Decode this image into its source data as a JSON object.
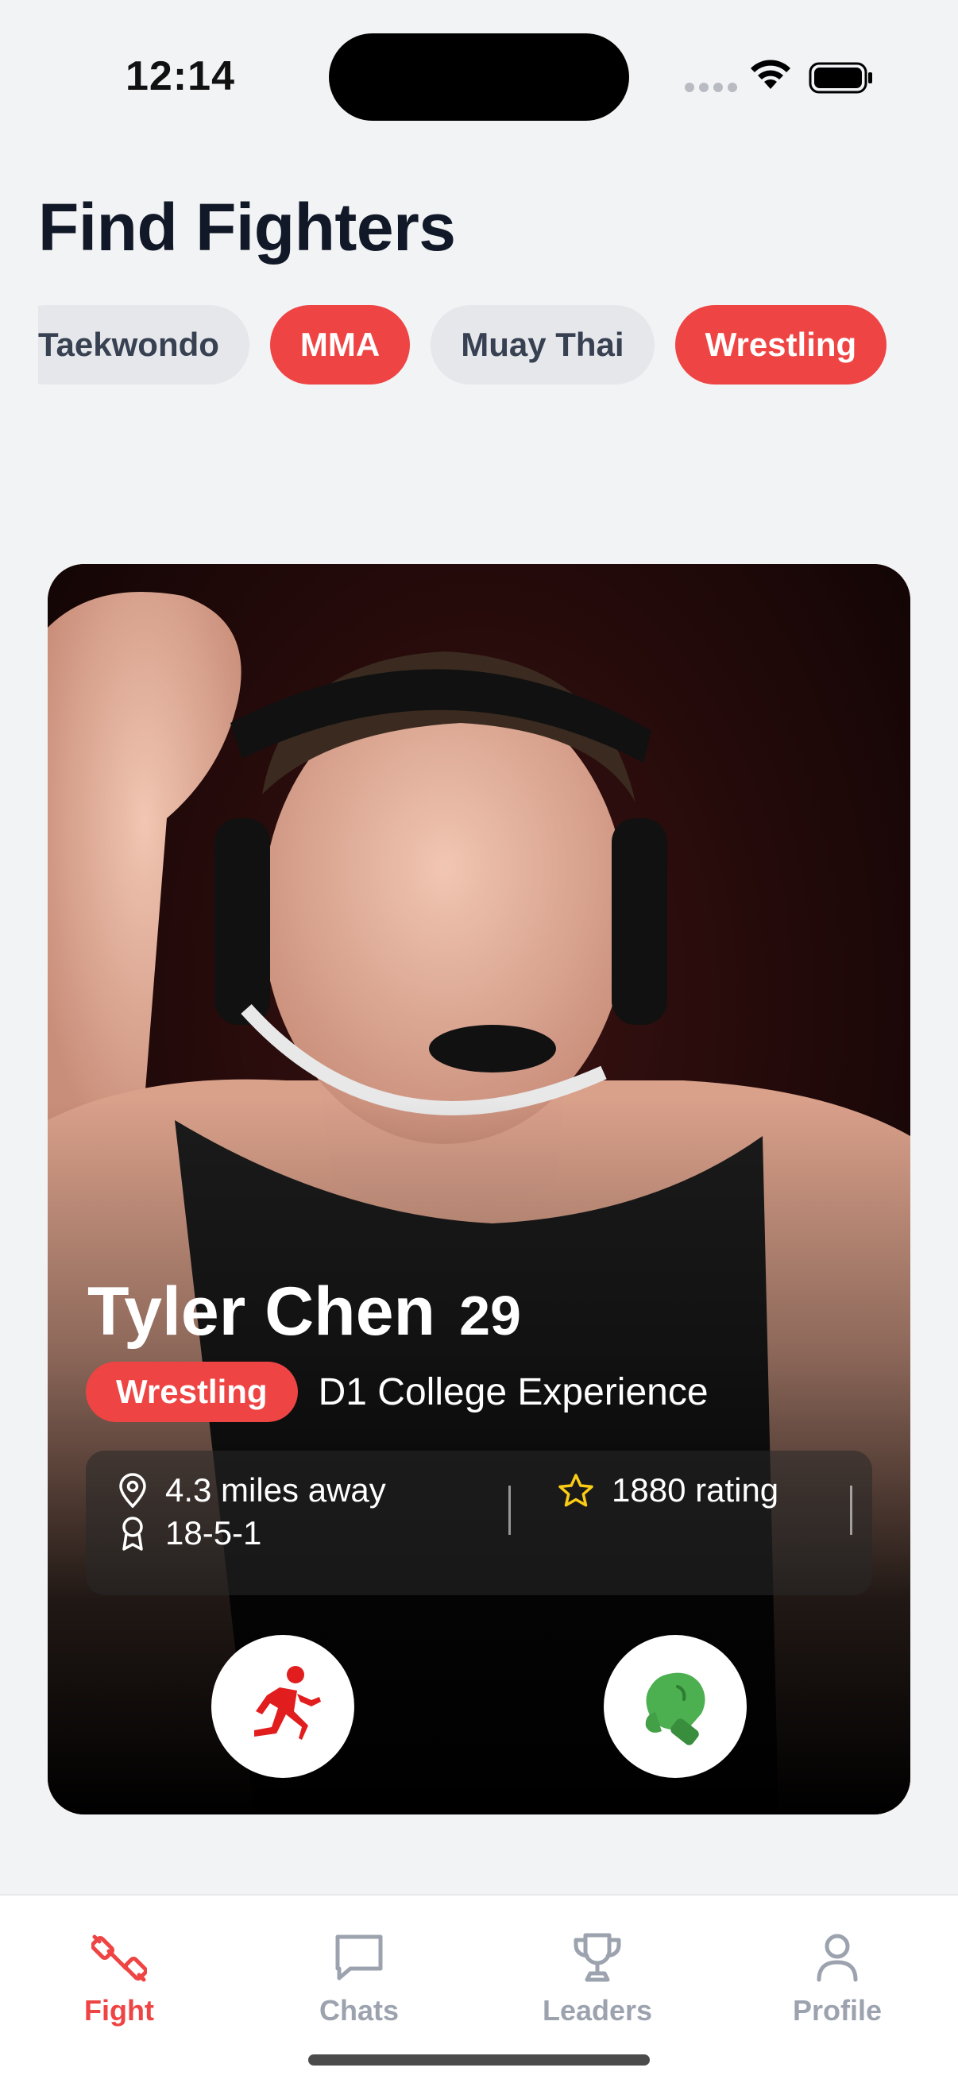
{
  "status": {
    "time": "12:14"
  },
  "header": {
    "title": "Find Fighters"
  },
  "filters": [
    {
      "label": "Taekwondo",
      "selected": false
    },
    {
      "label": "MMA",
      "selected": true
    },
    {
      "label": "Muay Thai",
      "selected": false
    },
    {
      "label": "Wrestling",
      "selected": true
    }
  ],
  "card": {
    "name": "Tyler Chen",
    "age": "29",
    "sport": "Wrestling",
    "experience": "D1 College Experience",
    "distance": "4.3 miles away",
    "rating": "1880 rating",
    "record": "18-5-1",
    "actions": {
      "pass_icon": "running-person-icon",
      "fight_icon": "boxing-glove-icon"
    }
  },
  "tabs": [
    {
      "label": "Fight",
      "icon": "dumbbell-icon",
      "active": true
    },
    {
      "label": "Chats",
      "icon": "chat-bubble-icon",
      "active": false
    },
    {
      "label": "Leaders",
      "icon": "trophy-icon",
      "active": false
    },
    {
      "label": "Profile",
      "icon": "person-icon",
      "active": false
    }
  ],
  "colors": {
    "accent": "#ef4444",
    "fight_green": "#4caf50",
    "star": "#facc15"
  }
}
